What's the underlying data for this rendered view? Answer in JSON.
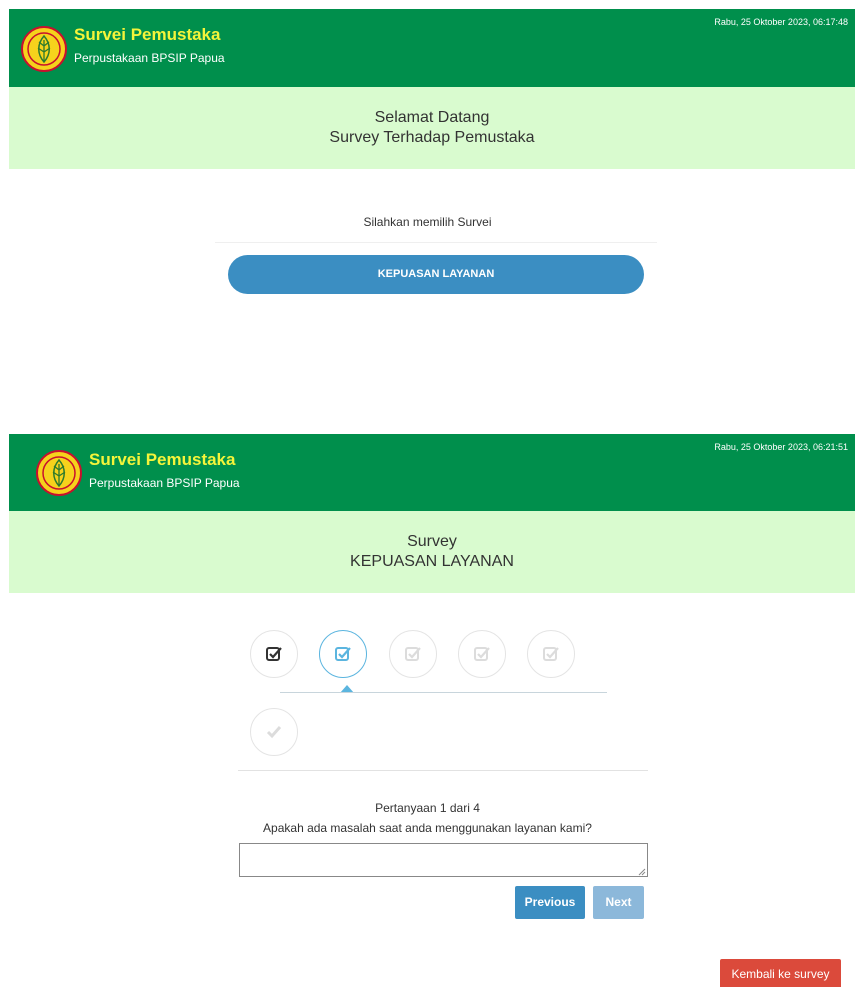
{
  "screen1": {
    "header": {
      "title": "Survei Pemustaka",
      "subtitle": "Perpustakaan BPSIP Papua",
      "datetime": "Rabu, 25 Oktober 2023, 06:17:48"
    },
    "banner": {
      "line1": "Selamat Datang",
      "line2": "Survey Terhadap Pemustaka"
    },
    "prompt": "Silahkan memilih Survei",
    "survey_button_label": "KEPUASAN LAYANAN"
  },
  "screen2": {
    "header": {
      "title": "Survei Pemustaka",
      "subtitle": "Perpustakaan BPSIP Papua",
      "datetime": "Rabu, 25 Oktober 2023, 06:21:51"
    },
    "banner": {
      "line1": "Survey",
      "line2": "KEPUASAN LAYANAN"
    },
    "steps": [
      {
        "icon": "checkbox-icon",
        "state": "done"
      },
      {
        "icon": "checkbox-icon",
        "state": "active"
      },
      {
        "icon": "checkbox-icon",
        "state": "pending"
      },
      {
        "icon": "checkbox-icon",
        "state": "pending"
      },
      {
        "icon": "checkbox-icon",
        "state": "pending"
      },
      {
        "icon": "checkmark-icon",
        "state": "pending"
      }
    ],
    "question_counter": "Pertanyaan 1 dari 4",
    "question": "Apakah ada masalah saat anda menggunakan layanan kami?",
    "answer_value": "",
    "previous_label": "Previous",
    "next_label": "Next",
    "back_label": "Kembali ke survey"
  },
  "colors": {
    "header_green": "#008f4c",
    "title_yellow": "#f4f43a",
    "banner_green": "#d9fbcf",
    "primary_blue": "#3b8ec2",
    "active_step_blue": "#5bb5df",
    "danger_red": "#db4a3b"
  }
}
